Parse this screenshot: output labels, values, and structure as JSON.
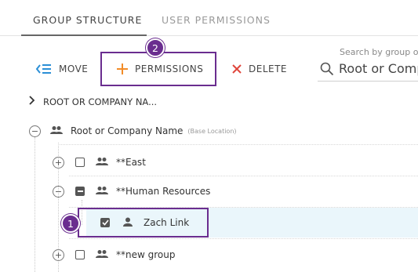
{
  "tabs": [
    {
      "label": "GROUP STRUCTURE",
      "active": true
    },
    {
      "label": "USER PERMISSIONS",
      "active": false
    }
  ],
  "toolbar": {
    "move_label": "MOVE",
    "permissions_label": "PERMISSIONS",
    "delete_label": "DELETE",
    "accent_color": "#2b8fd6",
    "permissions_icon_color": "#f28c28",
    "delete_icon_color": "#e0463c"
  },
  "search": {
    "caption": "Search by group o",
    "value": "Root or Comp"
  },
  "callouts": [
    {
      "number": "2",
      "target": "permissions-button"
    },
    {
      "number": "1",
      "target": "tree-row-zach-link"
    }
  ],
  "highlight_color": "#6a2d8f",
  "breadcrumb": {
    "label": "ROOT OR COMPANY NA..."
  },
  "tree": {
    "root": {
      "label": "Root or Company Name",
      "sublabel": "(Base Location)",
      "icon": "group-icon"
    },
    "items": [
      {
        "label": "**East",
        "icon": "group-icon",
        "checked": false
      },
      {
        "label": "**Human Resources",
        "icon": "group-icon",
        "checked": "partial"
      },
      {
        "label": "Zach Link",
        "icon": "person-icon",
        "checked": true,
        "selected": true
      },
      {
        "label": "**new group",
        "icon": "group-icon",
        "checked": false
      }
    ]
  }
}
